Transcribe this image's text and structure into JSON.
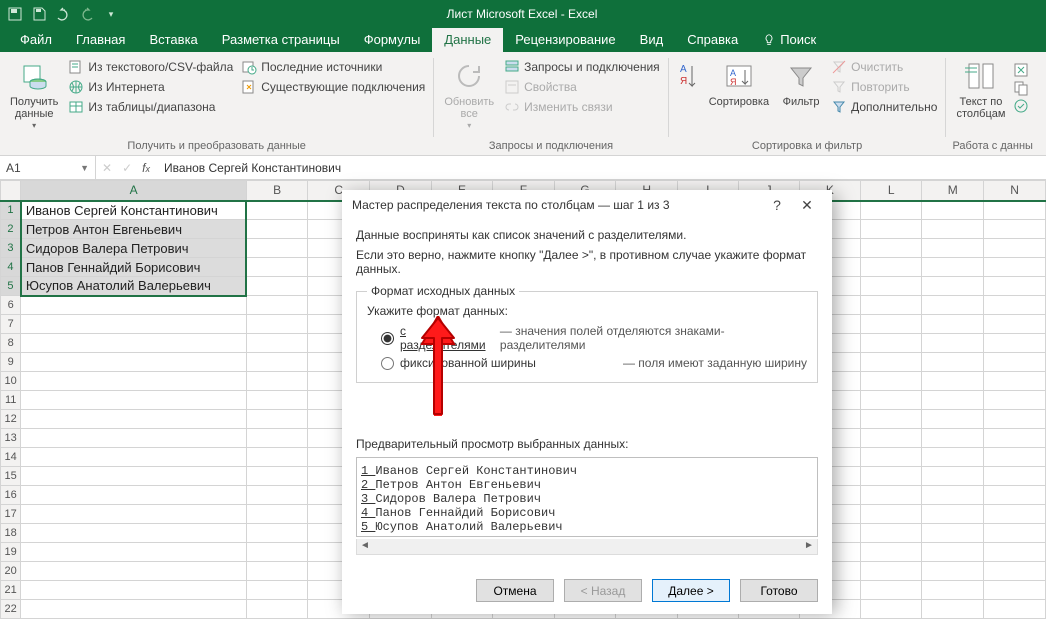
{
  "titlebar": {
    "title": "Лист Microsoft Excel  -  Excel"
  },
  "tabs": {
    "file": "Файл",
    "items": [
      "Главная",
      "Вставка",
      "Разметка страницы",
      "Формулы",
      "Данные",
      "Рецензирование",
      "Вид",
      "Справка"
    ],
    "active": "Данные",
    "search": "Поиск"
  },
  "ribbon": {
    "grp1": {
      "big": "Получить\nданные",
      "a": "Из текстового/CSV-файла",
      "b": "Из Интернета",
      "c": "Из таблицы/диапазона",
      "d": "Последние источники",
      "e": "Существующие подключения",
      "label": "Получить и преобразовать данные"
    },
    "grp2": {
      "big": "Обновить\nвсе",
      "a": "Запросы и подключения",
      "b": "Свойства",
      "c": "Изменить связи",
      "label": "Запросы и подключения"
    },
    "grp3": {
      "sort": "Сортировка",
      "filter": "Фильтр",
      "clear": "Очистить",
      "reapply": "Повторить",
      "adv": "Дополнительно",
      "label": "Сортировка и фильтр"
    },
    "grp4": {
      "big": "Текст по\nстолбцам",
      "label": "Работа с данны"
    }
  },
  "namebox": "A1",
  "formula": "Иванов Сергей Константинович",
  "columns": [
    "A",
    "B",
    "C",
    "D",
    "E",
    "F",
    "G",
    "H",
    "I",
    "J",
    "K",
    "L",
    "M",
    "N"
  ],
  "rows": 22,
  "dataColA": [
    "Иванов Сергей Константинович",
    "Петров Антон Евгеньевич",
    "Сидоров Валера Петрович",
    "Панов Геннайдий Борисович",
    "Юсупов Анатолий Валерьевич"
  ],
  "dialog": {
    "title": "Мастер распределения текста по столбцам — шаг 1 из 3",
    "line1": "Данные восприняты как список значений с разделителями.",
    "line2": "Если это верно, нажмите кнопку \"Далее >\", в противном случае укажите формат данных.",
    "fs_legend": "Формат исходных данных",
    "fs_prompt": "Укажите формат данных:",
    "opt1": "с разделителями",
    "opt1_desc": "— значения полей отделяются знаками-разделителями",
    "opt2": "фиксированной ширины",
    "opt2_desc": "— поля имеют заданную ширину",
    "preview_label": "Предварительный просмотр выбранных данных:",
    "preview": [
      "Иванов Сергей Константинович",
      "Петров Антон Евгеньевич",
      "Сидоров Валера Петрович",
      "Панов Геннайдий Борисович",
      "Юсупов Анатолий Валерьевич"
    ],
    "btn_cancel": "Отмена",
    "btn_back": "< Назад",
    "btn_next": "Далее >",
    "btn_finish": "Готово"
  }
}
